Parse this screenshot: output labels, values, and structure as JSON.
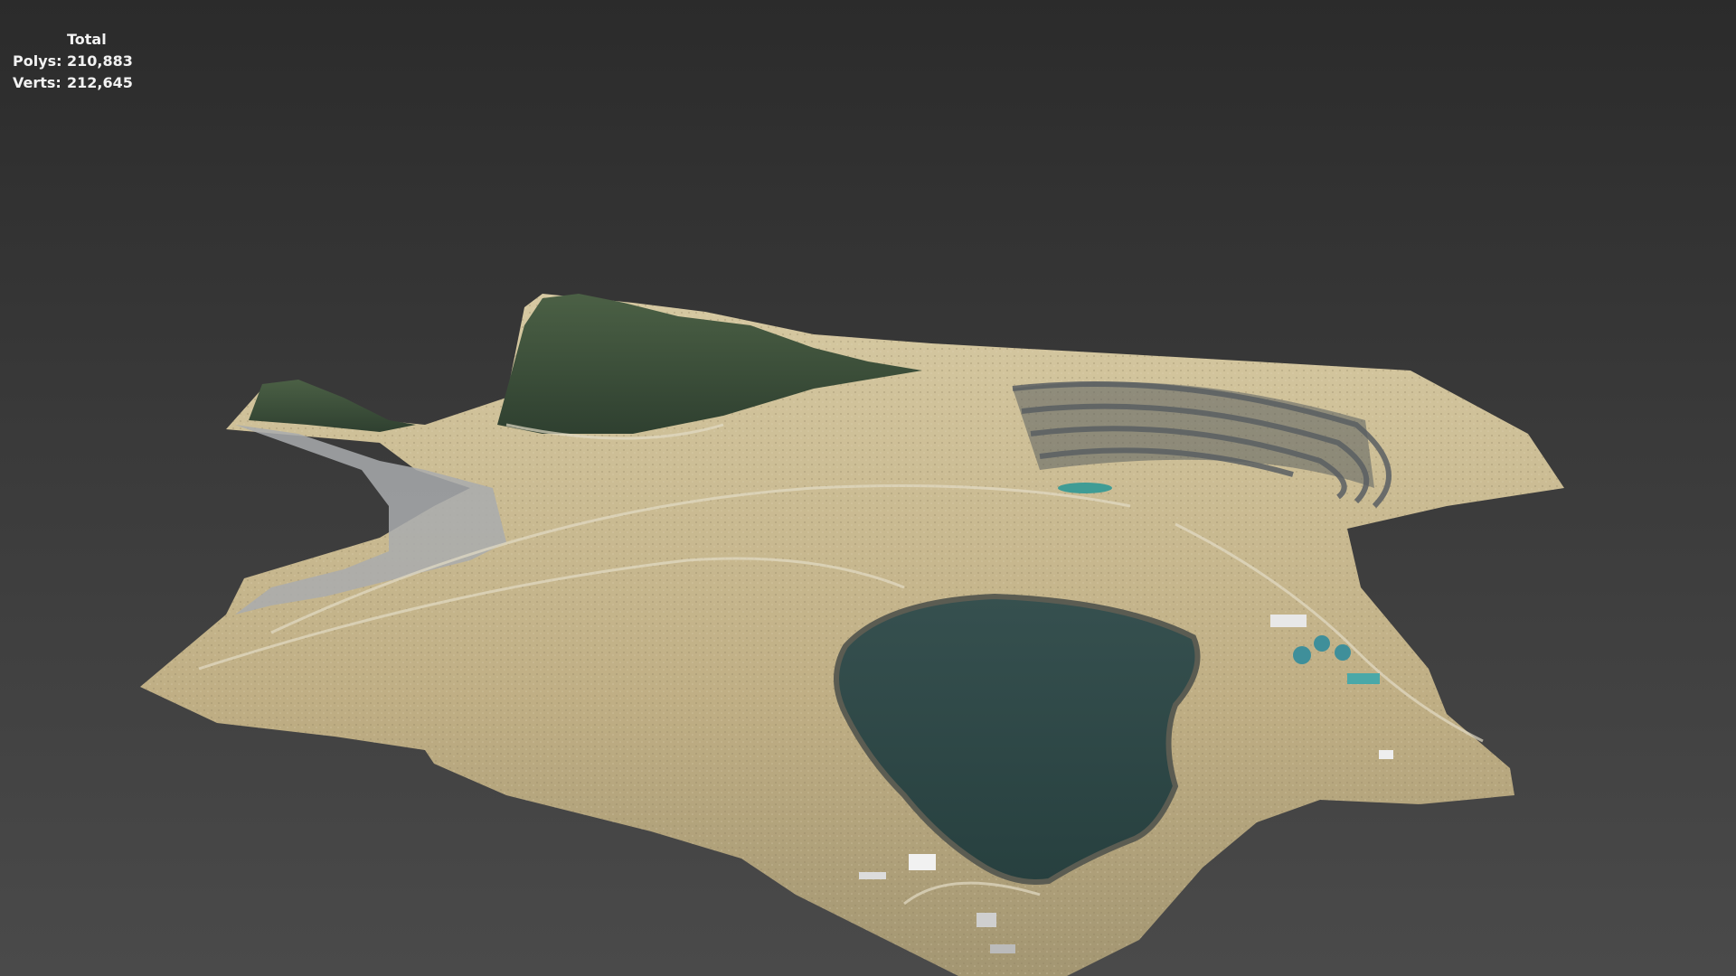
{
  "viewport": {
    "stats": {
      "header": "Total",
      "polys_label": "Polys:",
      "polys_value": "210,883",
      "verts_label": "Verts:",
      "verts_value": "212,645"
    },
    "background_colors": {
      "top": "#2b2b2b",
      "bottom": "#4a4a4a"
    }
  },
  "model": {
    "name": "open-pit-mine-terrain",
    "colors": {
      "ground": "#c9b98f",
      "ground_dark": "#9c8c68",
      "vegetation": "#3f553a",
      "water": "#2f4748",
      "gravel": "#a7a9a8",
      "teal_pond": "#3f9c95"
    }
  }
}
